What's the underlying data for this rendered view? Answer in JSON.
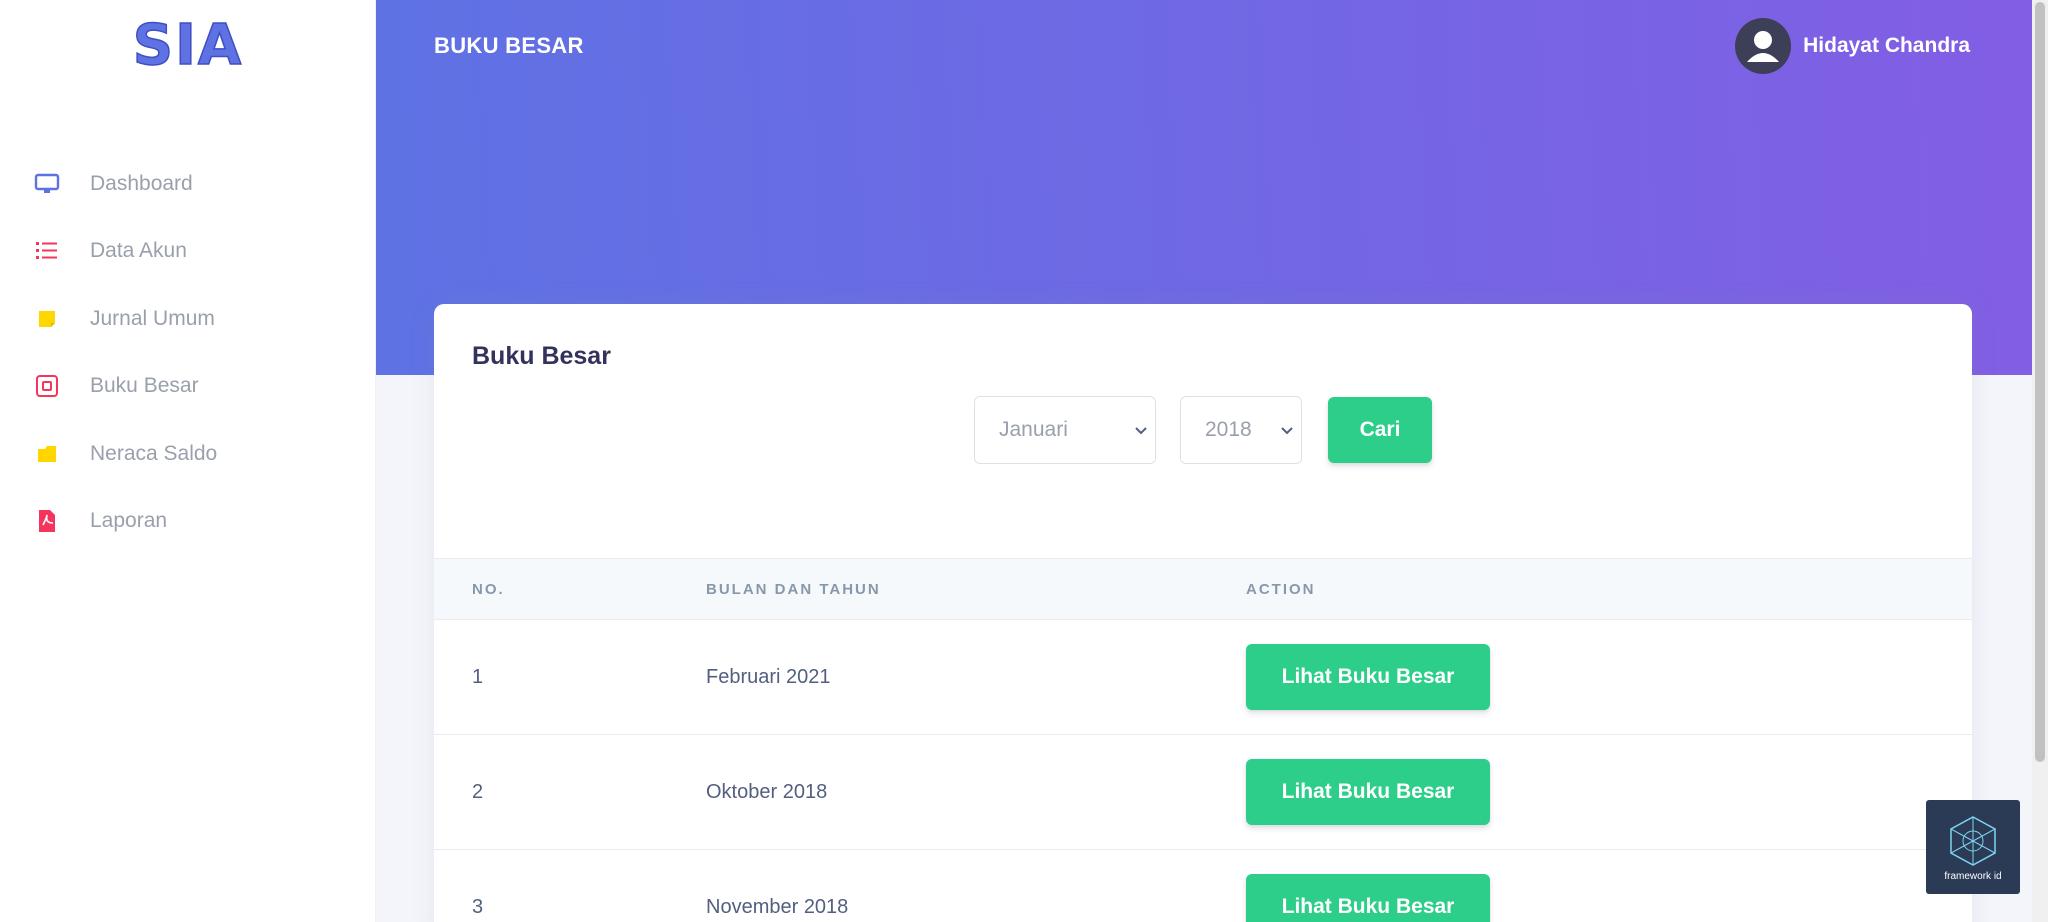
{
  "app": {
    "logo_text": "SIA"
  },
  "sidebar": {
    "items": [
      {
        "label": "Dashboard",
        "icon": "monitor-icon",
        "color": "#5e72e4"
      },
      {
        "label": "Data Akun",
        "icon": "list-icon",
        "color": "#f5365c"
      },
      {
        "label": "Jurnal Umum",
        "icon": "note-icon",
        "color": "#ffd600"
      },
      {
        "label": "Buku Besar",
        "icon": "ledger-icon",
        "color": "#f5365c"
      },
      {
        "label": "Neraca Saldo",
        "icon": "folder-icon",
        "color": "#ffd600"
      },
      {
        "label": "Laporan",
        "icon": "pdf-file-icon",
        "color": "#f5365c"
      }
    ]
  },
  "header": {
    "title": "BUKU BESAR",
    "user_name": "Hidayat Chandra"
  },
  "card": {
    "title": "Buku Besar",
    "filter": {
      "month_selected": "Januari",
      "year_selected": "2018",
      "search_label": "Cari"
    },
    "table": {
      "headers": [
        "NO.",
        "BULAN DAN TAHUN",
        "ACTION"
      ],
      "rows": [
        {
          "no": "1",
          "period": "Februari 2021",
          "action": "Lihat Buku Besar"
        },
        {
          "no": "2",
          "period": "Oktober 2018",
          "action": "Lihat Buku Besar"
        },
        {
          "no": "3",
          "period": "November 2018",
          "action": "Lihat Buku Besar"
        }
      ]
    }
  },
  "watermark": {
    "text": "framework id"
  },
  "colors": {
    "primary_gradient_start": "#5e72e4",
    "primary_gradient_end": "#825ee4",
    "success": "#2dce89"
  }
}
